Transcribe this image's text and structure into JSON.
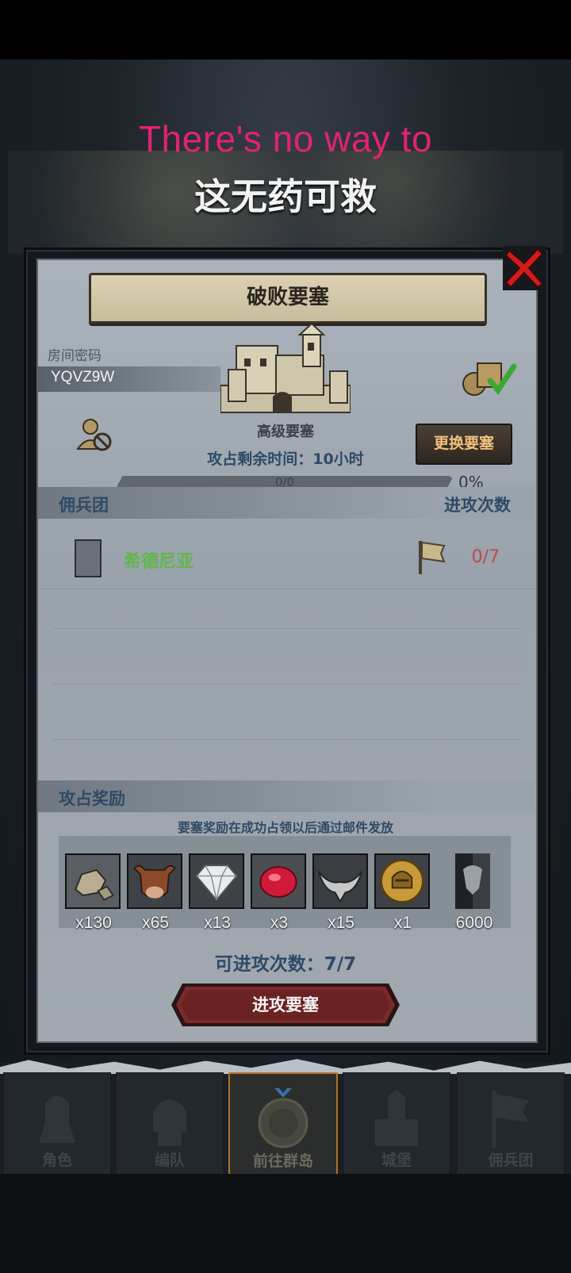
{
  "subtitles": {
    "english": "There's no way to",
    "chinese": "这无药可救"
  },
  "dialog": {
    "title": "破败要塞",
    "password_label": "房间密码",
    "password_value": "YQVZ9W",
    "fortress_type": "高级要塞",
    "change_button": "更换要塞",
    "time_remaining": "攻占剩余时间：10小时",
    "progress": {
      "text": "0/0",
      "percent_label": "0%",
      "fraction": 0
    }
  },
  "guild_section": {
    "header_left": "佣兵团",
    "header_right": "进攻次数",
    "rows": [
      {
        "name": "希德尼亚",
        "attacks": "0/7"
      }
    ]
  },
  "rewards": {
    "header": "攻占奖励",
    "note": "要塞奖励在成功占领以后通过邮件发放",
    "items": [
      {
        "icon": "stone-icon",
        "qty": "x130"
      },
      {
        "icon": "ox-icon",
        "qty": "x65"
      },
      {
        "icon": "diamond-icon",
        "qty": "x13"
      },
      {
        "icon": "ruby-icon",
        "qty": "x3"
      },
      {
        "icon": "horn-icon",
        "qty": "x15"
      },
      {
        "icon": "helmet-coin-icon",
        "qty": "x1"
      },
      {
        "icon": "guild-banner-icon",
        "qty": "6000"
      }
    ]
  },
  "attacks_available": "可进攻次数：7/7",
  "attack_button": "进攻要塞",
  "bottom_nav": [
    {
      "label": "角色",
      "active": false
    },
    {
      "label": "编队",
      "active": false
    },
    {
      "label": "前往群岛",
      "active": true
    },
    {
      "label": "城堡",
      "active": false
    },
    {
      "label": "佣兵团",
      "active": false
    }
  ],
  "colors": {
    "accent_blue": "#2f4a66",
    "guild_green": "#5fb84a",
    "attack_red": "#c0484b",
    "subtitle_pink": "#e0246e",
    "button_gold": "#f2c17c"
  }
}
